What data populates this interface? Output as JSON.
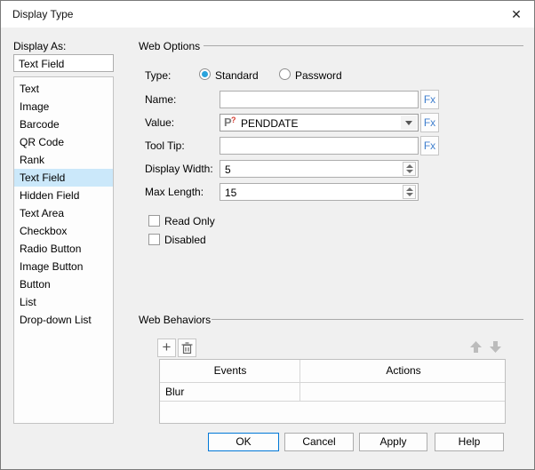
{
  "dialog": {
    "title": "Display Type"
  },
  "left_panel": {
    "label": "Display As:",
    "display_as_value": "Text Field",
    "selected_item": "Text Field",
    "items": [
      "Text",
      "Image",
      "Barcode",
      "QR Code",
      "Rank",
      "Text Field",
      "Hidden Field",
      "Text Area",
      "Checkbox",
      "Radio Button",
      "Image Button",
      "Button",
      "List",
      "Drop-down List"
    ]
  },
  "web_options": {
    "title": "Web Options",
    "type_label": "Type:",
    "type_selected": "Standard",
    "radio_standard": "Standard",
    "radio_password": "Password",
    "name_label": "Name:",
    "name_value": "",
    "value_label": "Value:",
    "value_value": "PENDDATE",
    "value_icon": "parameter-icon",
    "tooltip_label": "Tool Tip:",
    "tooltip_value": "",
    "display_width_label": "Display Width:",
    "display_width_value": "5",
    "max_length_label": "Max Length:",
    "max_length_value": "15",
    "checkbox_read_only": "Read Only",
    "checkbox_read_only_checked": false,
    "checkbox_disabled": "Disabled",
    "checkbox_disabled_checked": false,
    "fx_label": "Fx"
  },
  "web_behaviors": {
    "title": "Web Behaviors",
    "columns": [
      "Events",
      "Actions"
    ],
    "rows": [
      {
        "event": "Blur",
        "action": ""
      }
    ]
  },
  "footer": {
    "ok": "OK",
    "cancel": "Cancel",
    "apply": "Apply",
    "help": "Help"
  },
  "colors": {
    "accent": "#0078d7",
    "selection": "#cbe8fa",
    "fx_blue": "#3f7fce",
    "radio_blue": "#2aa3dc",
    "dialog_bg": "#f0f0f0"
  }
}
